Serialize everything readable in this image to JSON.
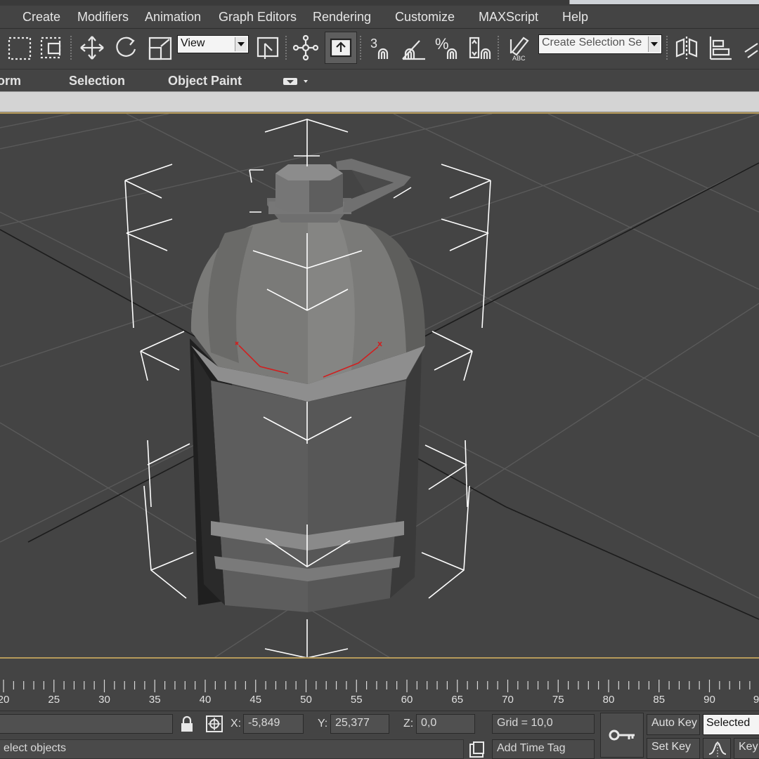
{
  "menu": {
    "items": [
      "Create",
      "Modifiers",
      "Animation",
      "Graph Editors",
      "Rendering",
      "Customize",
      "MAXScript",
      "Help"
    ]
  },
  "toolbar": {
    "reference_coord": "View",
    "named_selection_placeholder": "Create Selection Se",
    "snap_label": "3",
    "angle_snap_label": "",
    "percent_snap_label": "%",
    "abc_label": "ABC"
  },
  "ribbon": {
    "tabs": [
      "orm",
      "Selection",
      "Object Paint"
    ]
  },
  "timeline": {
    "ticks": [
      "20",
      "25",
      "30",
      "35",
      "40",
      "45",
      "50",
      "55",
      "60",
      "65",
      "70",
      "75",
      "80",
      "85",
      "90",
      "9"
    ]
  },
  "status": {
    "x_label": "X:",
    "x_value": "-5,849",
    "y_label": "Y:",
    "y_value": "25,377",
    "z_label": "Z:",
    "z_value": "0,0",
    "grid": "Grid = 10,0",
    "prompt": "elect objects",
    "add_time_tag": "Add Time Tag",
    "auto_key": "Auto Key",
    "set_key": "Set Key",
    "key_mode": "Selected",
    "key_filters": "Key"
  },
  "colors": {
    "ui_background": "#444444",
    "viewport_border": "#b69a5a",
    "bounding_box": "#ffffff",
    "pivot_axis": "#d02020"
  }
}
